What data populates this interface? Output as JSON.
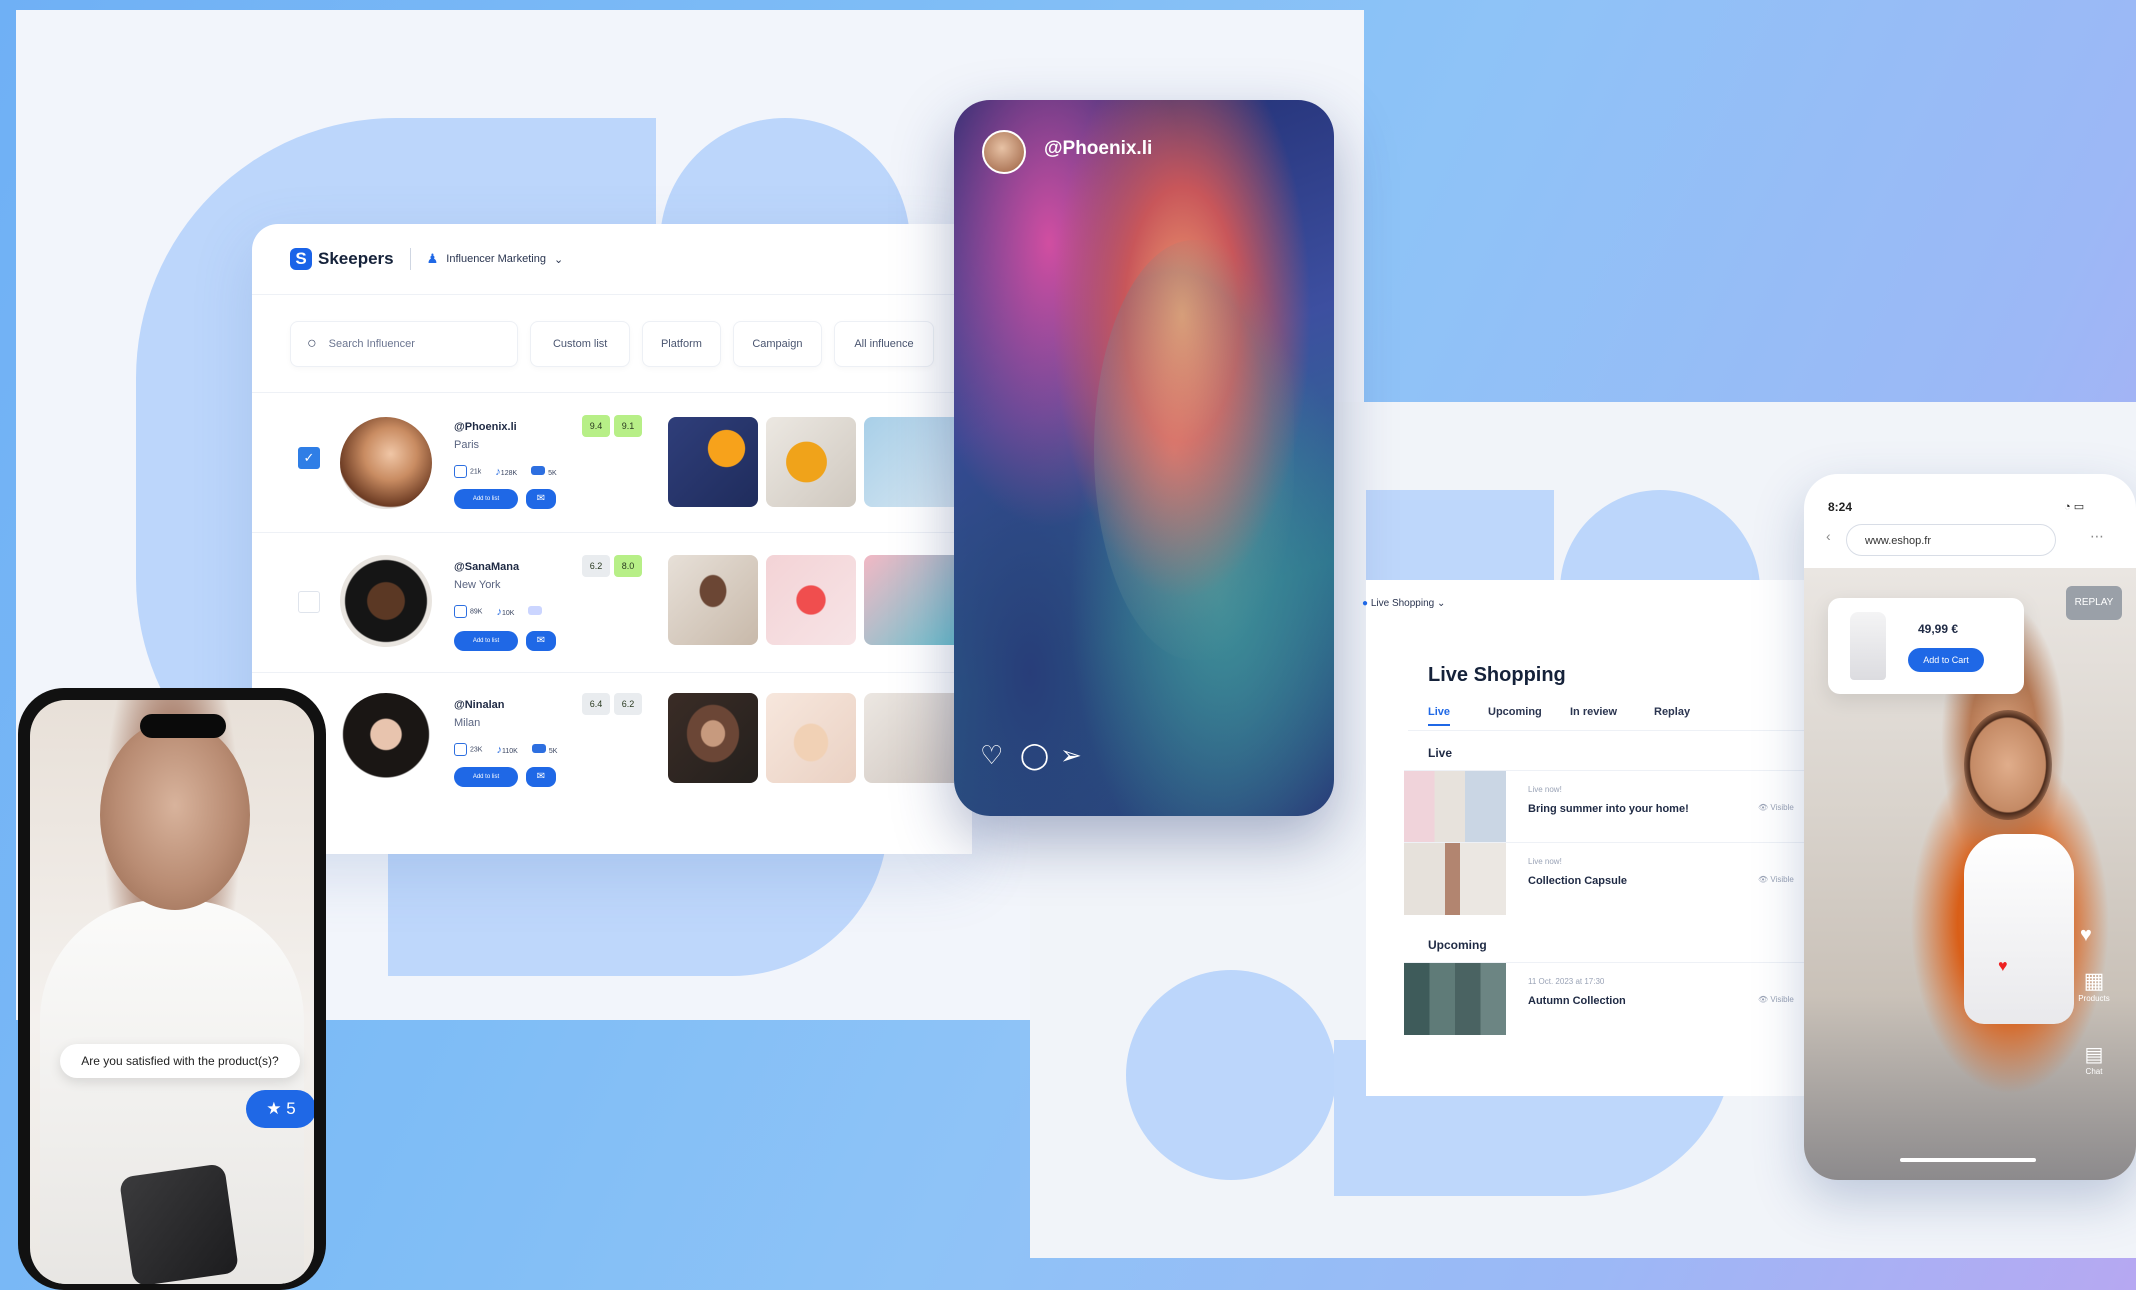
{
  "influencer_app": {
    "brand": "Skeepers",
    "module": "Influencer Marketing",
    "search_placeholder": "Search Influencer",
    "filters": [
      "Custom list",
      "Platform",
      "Campaign",
      "All influence"
    ],
    "rows": [
      {
        "handle": "@Phoenix.li",
        "city": "Paris",
        "stats": [
          "21k",
          "128K",
          "5K"
        ],
        "scores": [
          "9.4",
          "9.1"
        ],
        "checked": true,
        "add_label": "Add to list"
      },
      {
        "handle": "@SanaMana",
        "city": "New York",
        "stats": [
          "89K",
          "10K",
          ""
        ],
        "scores": [
          "6.2",
          "8.0"
        ],
        "checked": false,
        "add_label": "Add to list"
      },
      {
        "handle": "@Ninalan",
        "city": "Milan",
        "stats": [
          "23K",
          "110K",
          "5K"
        ],
        "scores": [
          "6.4",
          "6.2"
        ],
        "checked": false,
        "add_label": "Add to list"
      }
    ]
  },
  "portrait_card": {
    "handle": "@Phoenix.li"
  },
  "review_phone": {
    "question": "Are you satisfied with the product(s)?",
    "rating": "★ 5"
  },
  "live_shopping": {
    "module": "Live Shopping",
    "title": "Live Shopping",
    "tabs": [
      "Live",
      "Upcoming",
      "In review",
      "Replay"
    ],
    "sections": {
      "live": "Live",
      "upcoming": "Upcoming"
    },
    "items": [
      {
        "meta": "Live now!",
        "title": "Bring summer into your home!",
        "status": "Visible"
      },
      {
        "meta": "Live now!",
        "title": "Collection Capsule",
        "status": "Visible"
      },
      {
        "meta": "11 Oct. 2023 at 17:30",
        "title": "Autumn Collection",
        "status": "Visible"
      }
    ]
  },
  "shop_phone": {
    "time": "8:24",
    "url": "www.eshop.fr",
    "replay": "REPLAY",
    "price": "49,99 €",
    "cart": "Add to Cart",
    "side": [
      "Products",
      "Chat"
    ]
  },
  "colors": {
    "accent": "#1f68e6",
    "score_green": "#b7ef87",
    "score_grey": "#e9ecef"
  }
}
